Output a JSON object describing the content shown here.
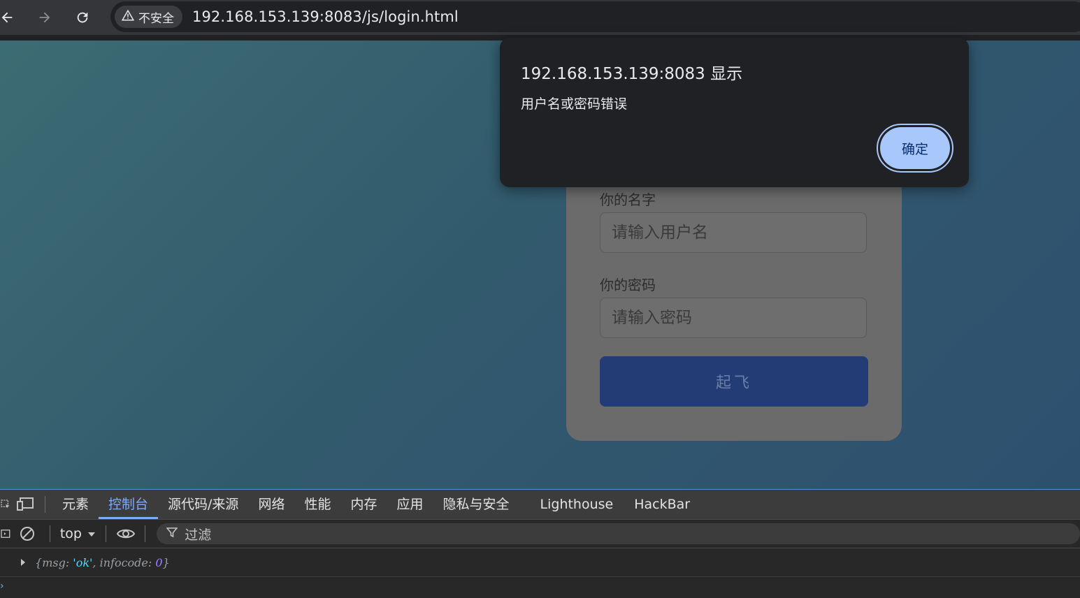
{
  "browser": {
    "security_label": "不安全",
    "url": "192.168.153.139:8083/js/login.html",
    "icons": [
      "back-arrow-icon",
      "forward-arrow-icon",
      "reload-icon",
      "warning-triangle-icon"
    ]
  },
  "login_form": {
    "username_label": "你的名字",
    "username_placeholder": "请输入用户名",
    "password_label": "你的密码",
    "password_placeholder": "请输入密码",
    "submit_label": "起飞"
  },
  "alert": {
    "title": "192.168.153.139:8083 显示",
    "message": "用户名或密码错误",
    "ok_label": "确定"
  },
  "devtools": {
    "tabs": [
      {
        "label": "元素",
        "active": false
      },
      {
        "label": "控制台",
        "active": true
      },
      {
        "label": "源代码/来源",
        "active": false
      },
      {
        "label": "网络",
        "active": false
      },
      {
        "label": "性能",
        "active": false
      },
      {
        "label": "内存",
        "active": false
      },
      {
        "label": "应用",
        "active": false
      },
      {
        "label": "隐私与安全",
        "active": false
      },
      {
        "label": "Lighthouse",
        "active": false
      },
      {
        "label": "HackBar",
        "active": false
      }
    ],
    "context": "top",
    "filter_label": "过滤",
    "console_log": {
      "open": "{",
      "key1": "msg",
      "val1": "'ok'",
      "key2": "infocode",
      "val2": "0",
      "close": "}"
    }
  },
  "colors": {
    "accent": "#7cacf8",
    "dialog_button": "#a8c7fa",
    "submit_button": "#243c76"
  }
}
